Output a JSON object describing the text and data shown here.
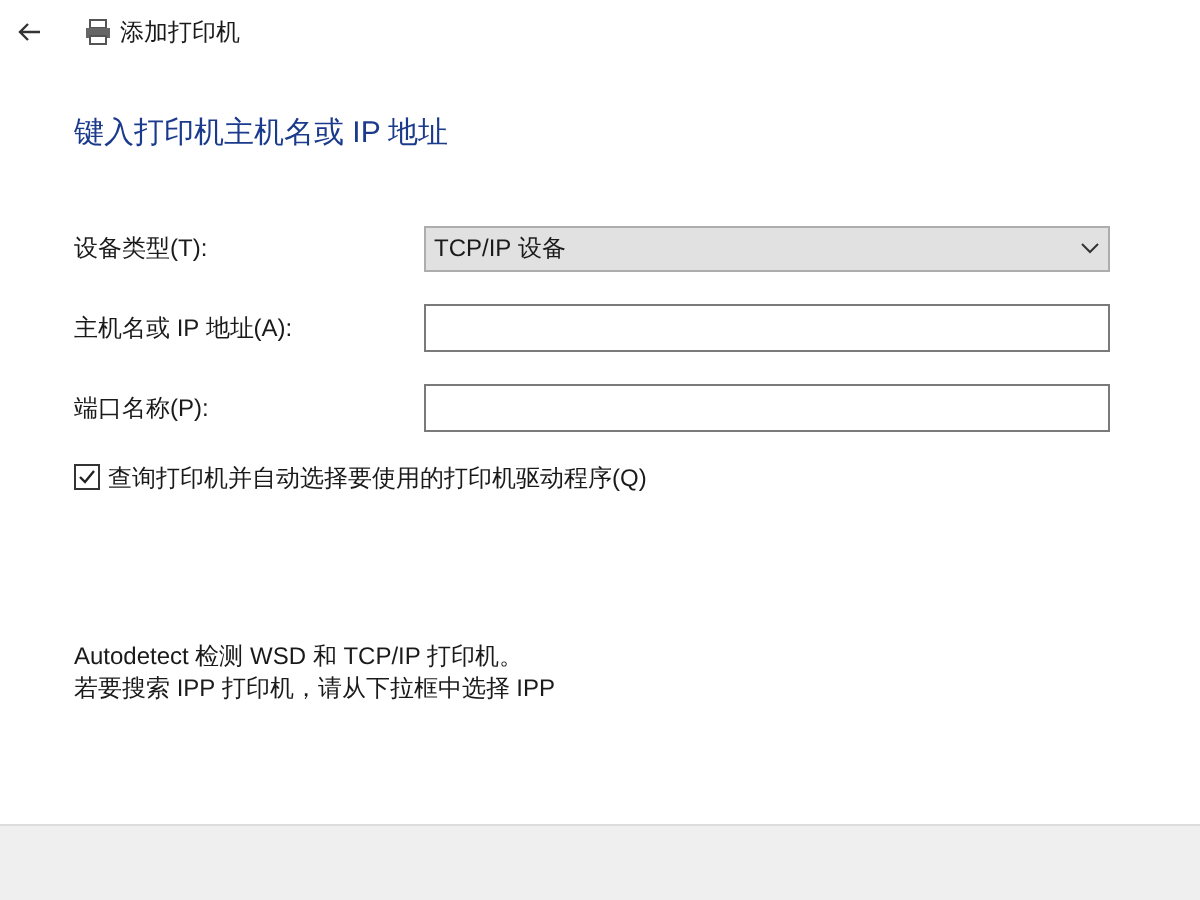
{
  "window": {
    "title": "添加打印机"
  },
  "heading": "键入打印机主机名或 IP 地址",
  "fields": [
    {
      "kind": "dropdown",
      "label": "设备类型(T):",
      "value": "TCP/IP 设备"
    },
    {
      "kind": "text",
      "label": "主机名或 IP 地址(A):"
    },
    {
      "kind": "text",
      "label": "端口名称(P):"
    }
  ],
  "query_option": {
    "label": "查询打印机并自动选择要使用的打印机驱动程序(Q)",
    "checked": true
  },
  "description": [
    "Autodetect 检测 WSD 和 TCP/IP 打印机。",
    "若要搜索 IPP 打印机，请从下拉框中选择 IPP"
  ]
}
